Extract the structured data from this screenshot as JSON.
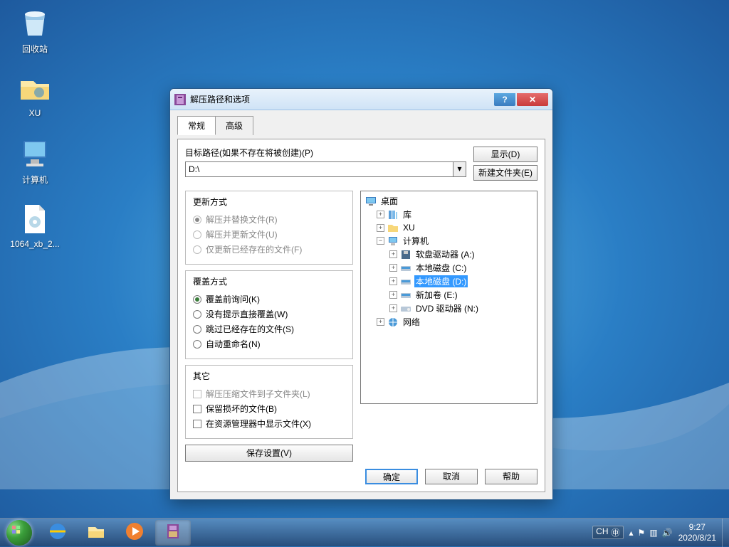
{
  "desktop": {
    "icons": [
      {
        "label": "回收站"
      },
      {
        "label": "XU"
      },
      {
        "label": "计算机"
      },
      {
        "label": "1064_xb_2..."
      }
    ]
  },
  "dialog": {
    "title": "解压路径和选项",
    "tabs": {
      "general": "常规",
      "advanced": "高级"
    },
    "path_label": "目标路径(如果不存在将被创建)(P)",
    "path_value": "D:\\",
    "btn_display": "显示(D)",
    "btn_new_folder": "新建文件夹(E)",
    "group_update": {
      "title": "更新方式",
      "opt1": "解压并替换文件(R)",
      "opt2": "解压并更新文件(U)",
      "opt3": "仅更新已经存在的文件(F)"
    },
    "group_overwrite": {
      "title": "覆盖方式",
      "opt1": "覆盖前询问(K)",
      "opt2": "没有提示直接覆盖(W)",
      "opt3": "跳过已经存在的文件(S)",
      "opt4": "自动重命名(N)"
    },
    "group_misc": {
      "title": "其它",
      "opt1": "解压压缩文件到子文件夹(L)",
      "opt2": "保留损坏的文件(B)",
      "opt3": "在资源管理器中显示文件(X)"
    },
    "btn_save": "保存设置(V)",
    "tree": {
      "desktop": "桌面",
      "lib": "库",
      "xu": "XU",
      "computer": "计算机",
      "floppy": "软盘驱动器 (A:)",
      "c": "本地磁盘 (C:)",
      "d": "本地磁盘 (D:)",
      "e": "新加卷 (E:)",
      "dvd": "DVD 驱动器 (N:)",
      "network": "网络"
    },
    "btn_ok": "确定",
    "btn_cancel": "取消",
    "btn_help": "帮助"
  },
  "taskbar": {
    "lang": "CH",
    "time": "9:27",
    "date": "2020/8/21"
  }
}
